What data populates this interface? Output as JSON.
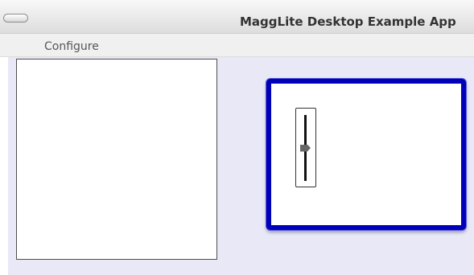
{
  "window": {
    "title": "MaggLite Desktop Example App"
  },
  "menubar": {
    "items": [
      {
        "label": "Configure"
      }
    ]
  },
  "slider": {
    "value_fraction": 0.5
  },
  "colors": {
    "title_text": "#333333",
    "menu_text": "#555555",
    "canvas_background": "#e8e8f7",
    "frame_border": "#0000b8",
    "panel_border": "#4f4f4f",
    "slider_track": "#111111",
    "slider_thumb": "#666666"
  },
  "icons": {
    "window_control": "window-control-icon"
  }
}
